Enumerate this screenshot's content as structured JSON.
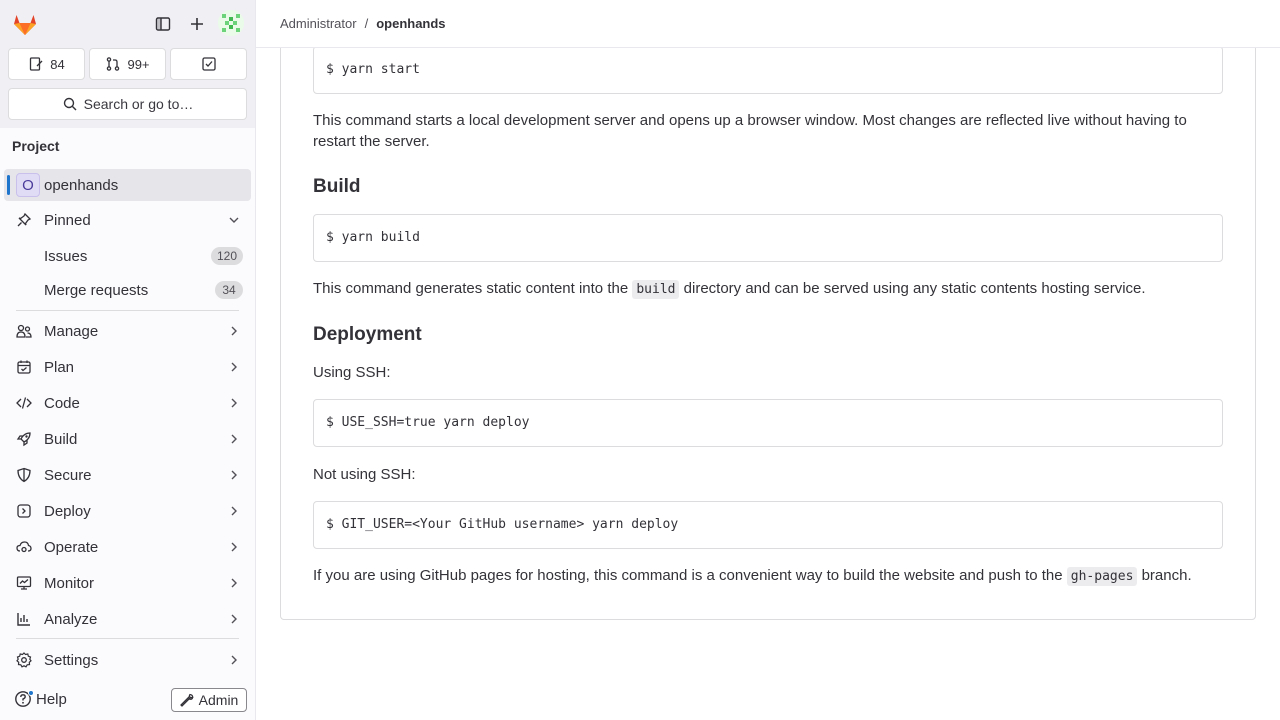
{
  "sidebar": {
    "counts": {
      "issues": "84",
      "merge_requests": "99+"
    },
    "search_label": "Search or go to…",
    "section_title": "Project",
    "project_initial": "O",
    "project_name": "openhands",
    "pinned": {
      "label": "Pinned",
      "items": [
        {
          "label": "Issues",
          "count": "120"
        },
        {
          "label": "Merge requests",
          "count": "34"
        }
      ]
    },
    "nav": [
      {
        "label": "Manage",
        "icon": "users-icon"
      },
      {
        "label": "Plan",
        "icon": "calendar-icon"
      },
      {
        "label": "Code",
        "icon": "code-icon"
      },
      {
        "label": "Build",
        "icon": "rocket-icon"
      },
      {
        "label": "Secure",
        "icon": "shield-icon"
      },
      {
        "label": "Deploy",
        "icon": "deployments-icon"
      },
      {
        "label": "Operate",
        "icon": "cloud-gear-icon"
      },
      {
        "label": "Monitor",
        "icon": "monitor-icon"
      },
      {
        "label": "Analyze",
        "icon": "chart-icon"
      }
    ],
    "settings_label": "Settings",
    "help_label": "Help",
    "admin_label": "Admin"
  },
  "header": {
    "breadcrumb_parent": "Administrator",
    "breadcrumb_sep": "/",
    "breadcrumb_current": "openhands"
  },
  "content": {
    "code_start": "$ yarn start",
    "para_start": "This command starts a local development server and opens up a browser window. Most changes are reflected live without having to restart the server.",
    "heading_build": "Build",
    "code_build": "$ yarn build",
    "para_build_before": "This command generates static content into the ",
    "para_build_code": "build",
    "para_build_after": " directory and can be served using any static contents hosting service.",
    "heading_deploy": "Deployment",
    "para_ssh": "Using SSH:",
    "code_ssh": "$ USE_SSH=true yarn deploy",
    "para_nossh": "Not using SSH:",
    "code_nossh": "$ GIT_USER=<Your GitHub username> yarn deploy",
    "para_pages_before": "If you are using GitHub pages for hosting, this command is a convenient way to build the website and push to the ",
    "para_pages_code": "gh-pages",
    "para_pages_after": " branch."
  },
  "colors": {
    "accent": "#1f75cb",
    "sidebar_bg": "#fbfafd",
    "active_item": "#e6e5ea"
  }
}
